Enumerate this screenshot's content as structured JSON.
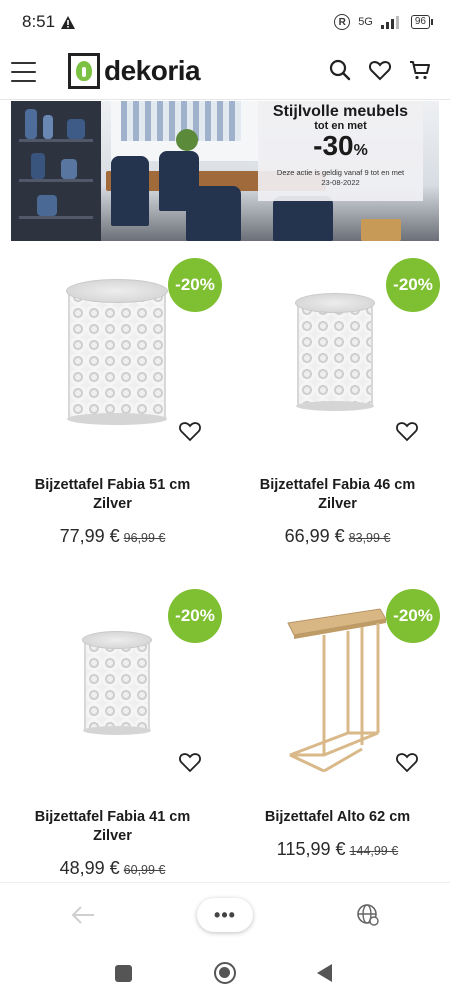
{
  "status_bar": {
    "time": "8:51",
    "network": "5G",
    "battery": "96"
  },
  "header": {
    "logo_text": "dekoria"
  },
  "banner": {
    "title": "Stijlvolle meubels",
    "subtitle": "tot en met",
    "discount": "-30",
    "percent_sign": "%",
    "note_line1": "Deze actie is geldig vanaf 9 tot en met",
    "note_line2": "23-08-2022"
  },
  "products": [
    {
      "name": "Bijzettafel Fabia 51 cm Zilver",
      "badge": "-20%",
      "price": "77,99 €",
      "old_price": "96,99 €"
    },
    {
      "name": "Bijzettafel Fabia 46 cm Zilver",
      "badge": "-20%",
      "price": "66,99 €",
      "old_price": "83,99 €"
    },
    {
      "name": "Bijzettafel Fabia 41 cm Zilver",
      "badge": "-20%",
      "price": "48,99 €",
      "old_price": "60,99 €"
    },
    {
      "name": "Bijzettafel Alto 62 cm",
      "badge": "-20%",
      "price": "115,99 €",
      "old_price": "144,99 €"
    }
  ],
  "browser_bar": {
    "more_label": "•••"
  },
  "colors": {
    "badge_green": "#7fbf32",
    "logo_leaf": "#7cc242",
    "text_dark": "#1c1c1c"
  }
}
